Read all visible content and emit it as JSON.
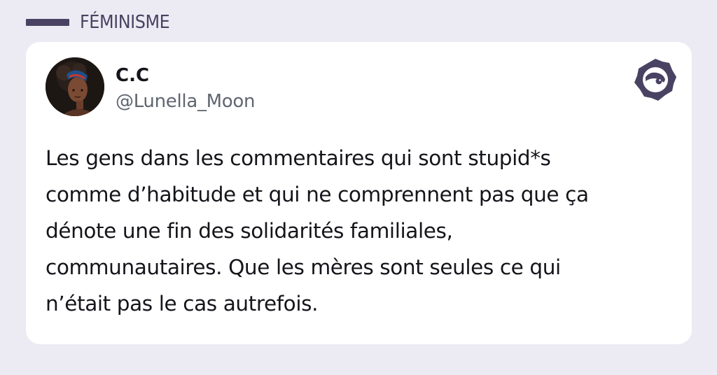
{
  "category": {
    "label": "FÉMINISME",
    "color": "#4a4262"
  },
  "tweet": {
    "author_name": "C.C",
    "author_handle": "@Lunella_Moon",
    "avatar_icon": "profile-avatar",
    "brand_icon": "brand-logo-icon",
    "text": "Les gens dans les commentaires qui sont stupid*s\ncomme d’habitude et qui ne comprennent pas que ça\ndénote une fin des solidarités familiales,\ncommunautaires. Que les mères sont seules ce qui\nn’était pas le cas autrefois."
  },
  "colors": {
    "background": "#ecebf3",
    "card": "#ffffff",
    "brand": "#4a4262"
  }
}
